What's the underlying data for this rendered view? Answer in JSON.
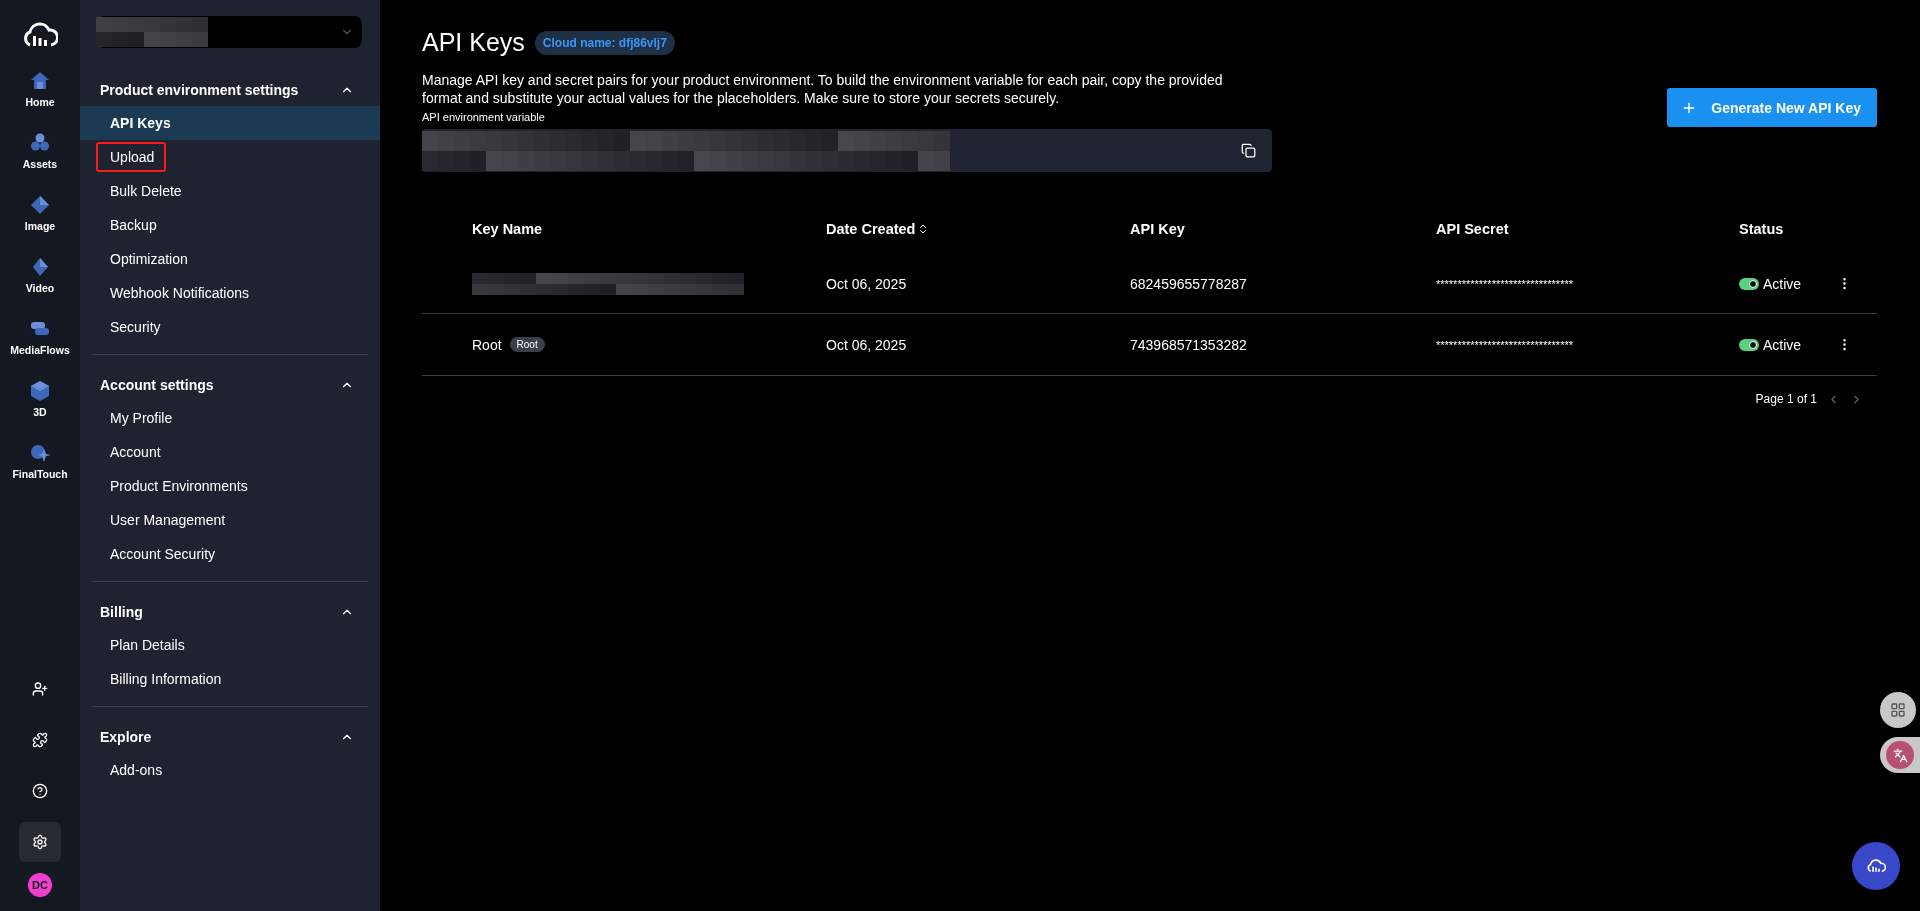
{
  "rail": {
    "items": [
      {
        "label": "Home",
        "kind": "home"
      },
      {
        "label": "Assets",
        "kind": "assets"
      },
      {
        "label": "Image",
        "kind": "image"
      },
      {
        "label": "Video",
        "kind": "video"
      },
      {
        "label": "MediaFlows",
        "kind": "flows"
      },
      {
        "label": "3D",
        "kind": "cube"
      },
      {
        "label": "FinalTouch",
        "kind": "spark"
      }
    ],
    "bottom": [
      {
        "kind": "add-user",
        "selected": false
      },
      {
        "kind": "puzzle",
        "selected": false
      },
      {
        "kind": "help",
        "selected": false
      },
      {
        "kind": "settings",
        "selected": true
      }
    ],
    "avatar": "DC"
  },
  "sidebar": {
    "sections": [
      {
        "title": "Product environment settings",
        "expanded": true,
        "items": [
          {
            "label": "API Keys",
            "selected": true,
            "highlighted": false
          },
          {
            "label": "Upload",
            "selected": false,
            "highlighted": true
          },
          {
            "label": "Bulk Delete",
            "selected": false,
            "highlighted": false
          },
          {
            "label": "Backup",
            "selected": false,
            "highlighted": false
          },
          {
            "label": "Optimization",
            "selected": false,
            "highlighted": false
          },
          {
            "label": "Webhook Notifications",
            "selected": false,
            "highlighted": false
          },
          {
            "label": "Security",
            "selected": false,
            "highlighted": false
          }
        ]
      },
      {
        "title": "Account settings",
        "expanded": true,
        "items": [
          {
            "label": "My Profile",
            "selected": false,
            "highlighted": false
          },
          {
            "label": "Account",
            "selected": false,
            "highlighted": false
          },
          {
            "label": "Product Environments",
            "selected": false,
            "highlighted": false
          },
          {
            "label": "User Management",
            "selected": false,
            "highlighted": false
          },
          {
            "label": "Account Security",
            "selected": false,
            "highlighted": false
          }
        ]
      },
      {
        "title": "Billing",
        "expanded": true,
        "items": [
          {
            "label": "Plan Details",
            "selected": false,
            "highlighted": false
          },
          {
            "label": "Billing Information",
            "selected": false,
            "highlighted": false
          }
        ]
      },
      {
        "title": "Explore",
        "expanded": true,
        "items": [
          {
            "label": "Add-ons",
            "selected": false,
            "highlighted": false
          }
        ]
      }
    ]
  },
  "page": {
    "title": "API Keys",
    "cloud_badge": "Cloud name: dfj86vlj7",
    "description": "Manage API key and secret pairs for your product environment. To build the environment variable for each pair, copy the provided format and substitute your actual values for the placeholders. Make sure to store your secrets securely.",
    "generate_button": "Generate New API Key",
    "env_label": "API environment variable"
  },
  "table": {
    "columns": [
      "Key Name",
      "Date Created",
      "API Key",
      "API Secret",
      "Status"
    ],
    "rows": [
      {
        "key_name": "",
        "tag": "",
        "date": "Oct 06, 2025",
        "api_key": "682459655778287",
        "api_secret": "********************************",
        "status": "Active",
        "on": true
      },
      {
        "key_name": "Root",
        "tag": "Root",
        "date": "Oct 06, 2025",
        "api_key": "743968571353282",
        "api_secret": "********************************",
        "status": "Active",
        "on": true
      }
    ]
  },
  "pagination": "Page 1 of 1"
}
